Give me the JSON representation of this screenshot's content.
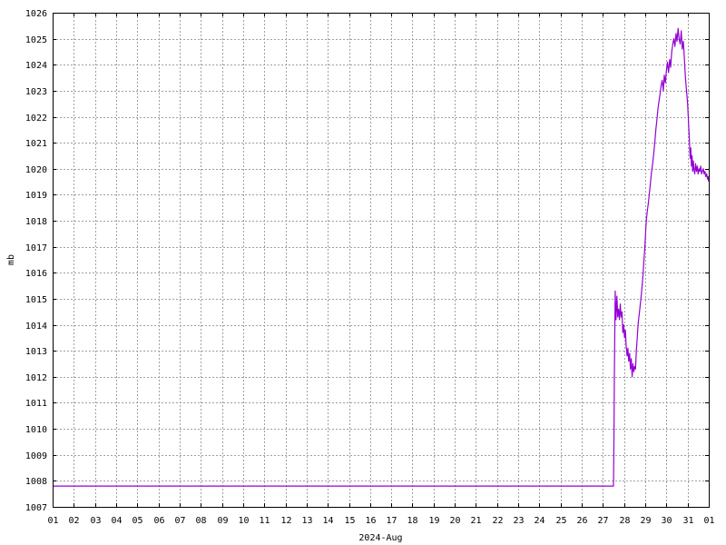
{
  "chart_data": {
    "type": "line",
    "title": "",
    "xlabel": "2024-Aug",
    "ylabel": "mb",
    "ylim": [
      1007,
      1026
    ],
    "xlim": [
      1,
      32
    ],
    "yticks": [
      1007,
      1008,
      1009,
      1010,
      1011,
      1012,
      1013,
      1014,
      1015,
      1016,
      1017,
      1018,
      1019,
      1020,
      1021,
      1022,
      1023,
      1024,
      1025,
      1026
    ],
    "xtick_labels": [
      "01",
      "02",
      "03",
      "04",
      "05",
      "06",
      "07",
      "08",
      "09",
      "10",
      "11",
      "12",
      "13",
      "14",
      "15",
      "16",
      "17",
      "18",
      "19",
      "20",
      "21",
      "22",
      "23",
      "24",
      "25",
      "26",
      "27",
      "28",
      "29",
      "30",
      "31",
      "01"
    ],
    "grid": true,
    "legend": "none",
    "line_color": "#9400d3",
    "series": [
      {
        "x": [
          1.0,
          27.5,
          27.52,
          27.54,
          27.58,
          27.62,
          27.66,
          27.7,
          27.74,
          27.78,
          27.82,
          27.86,
          27.9,
          27.94,
          27.98,
          28.02,
          28.06,
          28.1,
          28.14,
          28.18,
          28.22,
          28.26,
          28.3,
          28.34,
          28.38,
          28.42,
          28.46,
          28.5,
          28.54,
          28.58,
          28.62,
          28.66,
          28.7,
          28.74,
          28.78,
          28.82,
          28.86,
          28.9,
          28.94,
          28.98,
          29.02,
          29.06,
          29.1,
          29.15,
          29.2,
          29.25,
          29.3,
          29.35,
          29.4,
          29.45,
          29.5,
          29.55,
          29.6,
          29.65,
          29.7,
          29.75,
          29.8,
          29.85,
          29.9,
          29.95,
          30.0,
          30.05,
          30.1,
          30.15,
          30.2,
          30.25,
          30.3,
          30.35,
          30.4,
          30.45,
          30.5,
          30.55,
          30.6,
          30.65,
          30.7,
          30.75,
          30.8,
          30.85,
          30.9,
          30.95,
          31.0,
          31.03,
          31.06,
          31.09,
          31.12,
          31.15,
          31.18,
          31.21,
          31.24,
          31.27,
          31.3,
          31.34,
          31.38,
          31.42,
          31.46,
          31.5,
          31.54,
          31.58,
          31.62,
          31.66,
          31.7,
          31.74,
          31.78,
          31.82,
          31.86,
          31.9,
          31.94,
          31.97,
          32.0
        ],
        "y": [
          1007.8,
          1007.8,
          1009.5,
          1012.0,
          1015.3,
          1014.2,
          1015.1,
          1014.3,
          1014.6,
          1014.2,
          1014.8,
          1014.3,
          1014.5,
          1013.7,
          1014.0,
          1013.5,
          1013.8,
          1013.2,
          1012.8,
          1013.1,
          1012.6,
          1012.9,
          1012.3,
          1012.7,
          1012.0,
          1012.5,
          1012.2,
          1012.4,
          1012.3,
          1013.0,
          1013.5,
          1014.0,
          1014.3,
          1014.6,
          1014.9,
          1015.2,
          1015.6,
          1016.0,
          1016.5,
          1017.0,
          1017.6,
          1018.1,
          1018.4,
          1018.7,
          1019.1,
          1019.5,
          1019.9,
          1020.2,
          1020.6,
          1021.0,
          1021.5,
          1021.9,
          1022.3,
          1022.6,
          1022.9,
          1023.2,
          1023.4,
          1023.0,
          1023.6,
          1023.3,
          1023.8,
          1024.1,
          1023.7,
          1024.2,
          1023.9,
          1024.5,
          1024.8,
          1025.0,
          1024.7,
          1025.2,
          1024.9,
          1025.4,
          1025.0,
          1024.8,
          1025.3,
          1024.6,
          1024.9,
          1024.2,
          1023.5,
          1023.0,
          1022.5,
          1022.0,
          1021.5,
          1021.0,
          1020.4,
          1020.8,
          1020.1,
          1020.5,
          1019.9,
          1020.3,
          1020.0,
          1019.8,
          1020.2,
          1019.9,
          1020.1,
          1019.8,
          1020.0,
          1019.9,
          1020.1,
          1019.8,
          1019.9,
          1020.0,
          1019.8,
          1019.9,
          1019.7,
          1019.8,
          1019.6,
          1019.7,
          1019.5
        ]
      }
    ]
  }
}
